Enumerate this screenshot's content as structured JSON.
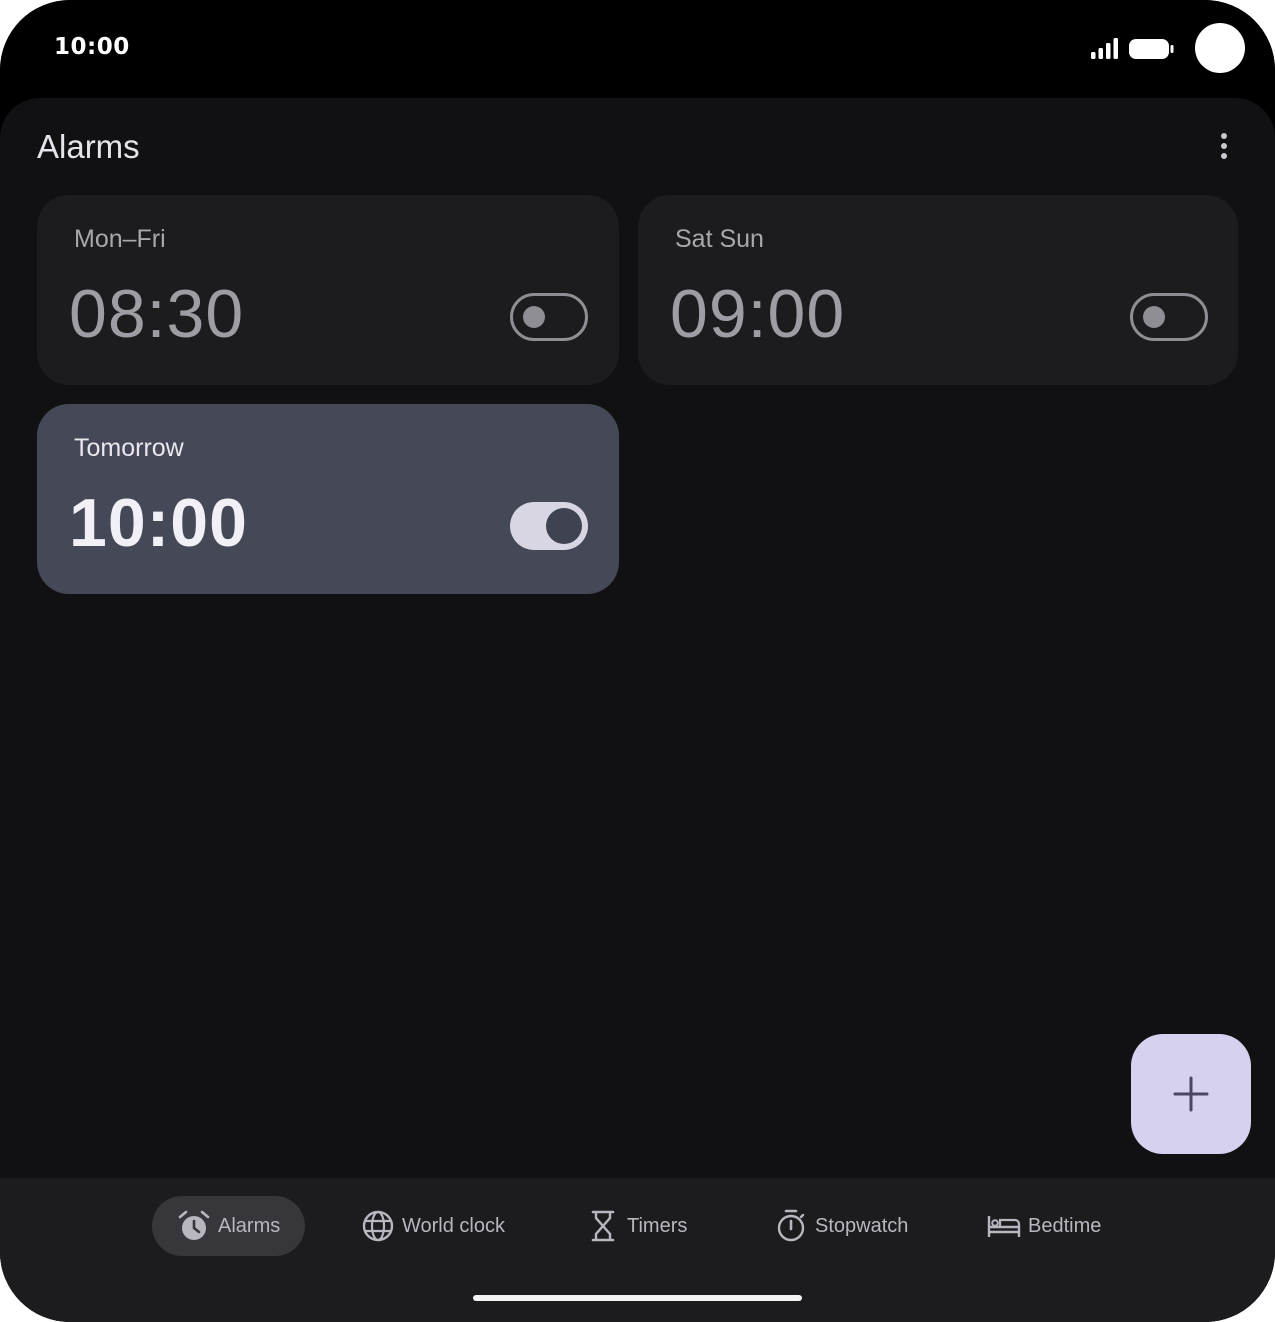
{
  "status_bar": {
    "time": "10:00"
  },
  "app": {
    "title": "Alarms"
  },
  "alarms": [
    {
      "label": "Mon–Fri",
      "time": "08:30",
      "enabled": false
    },
    {
      "label": "Sat Sun",
      "time": "09:00",
      "enabled": false
    },
    {
      "label": "Tomorrow",
      "time": "10:00",
      "enabled": true
    }
  ],
  "fab": {
    "icon": "plus-icon"
  },
  "nav": {
    "items": [
      {
        "label": "Alarms",
        "icon": "alarm-clock-icon",
        "selected": true
      },
      {
        "label": "World clock",
        "icon": "globe-icon",
        "selected": false
      },
      {
        "label": "Timers",
        "icon": "hourglass-icon",
        "selected": false
      },
      {
        "label": "Stopwatch",
        "icon": "stopwatch-icon",
        "selected": false
      },
      {
        "label": "Bedtime",
        "icon": "bed-icon",
        "selected": false
      }
    ]
  },
  "colors": {
    "background": "#111114",
    "card": "#1c1c1f",
    "card_active": "#454856",
    "fab": "#d6d1ee",
    "nav_background": "#1c1c1f"
  }
}
